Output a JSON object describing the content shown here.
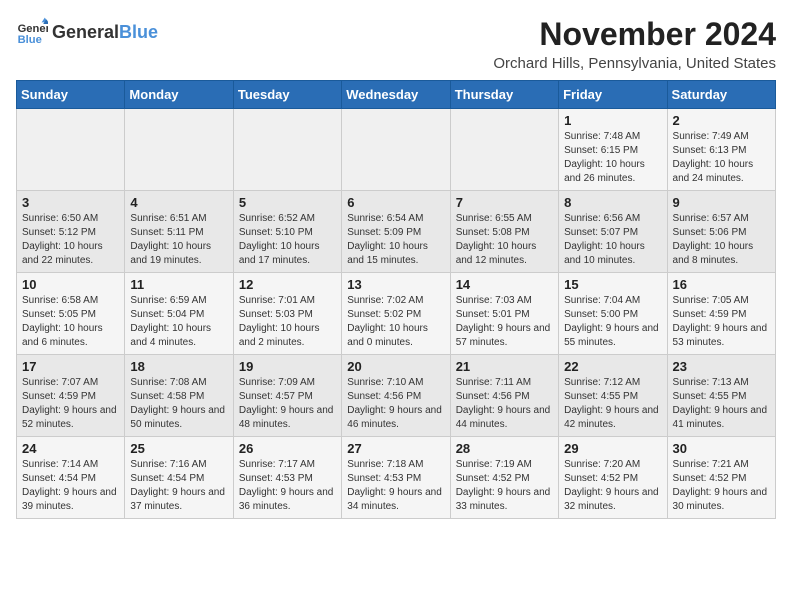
{
  "logo": {
    "general": "General",
    "blue": "Blue"
  },
  "title": "November 2024",
  "subtitle": "Orchard Hills, Pennsylvania, United States",
  "days_of_week": [
    "Sunday",
    "Monday",
    "Tuesday",
    "Wednesday",
    "Thursday",
    "Friday",
    "Saturday"
  ],
  "weeks": [
    [
      {
        "day": "",
        "info": ""
      },
      {
        "day": "",
        "info": ""
      },
      {
        "day": "",
        "info": ""
      },
      {
        "day": "",
        "info": ""
      },
      {
        "day": "",
        "info": ""
      },
      {
        "day": "1",
        "info": "Sunrise: 7:48 AM\nSunset: 6:15 PM\nDaylight: 10 hours and 26 minutes."
      },
      {
        "day": "2",
        "info": "Sunrise: 7:49 AM\nSunset: 6:13 PM\nDaylight: 10 hours and 24 minutes."
      }
    ],
    [
      {
        "day": "3",
        "info": "Sunrise: 6:50 AM\nSunset: 5:12 PM\nDaylight: 10 hours and 22 minutes."
      },
      {
        "day": "4",
        "info": "Sunrise: 6:51 AM\nSunset: 5:11 PM\nDaylight: 10 hours and 19 minutes."
      },
      {
        "day": "5",
        "info": "Sunrise: 6:52 AM\nSunset: 5:10 PM\nDaylight: 10 hours and 17 minutes."
      },
      {
        "day": "6",
        "info": "Sunrise: 6:54 AM\nSunset: 5:09 PM\nDaylight: 10 hours and 15 minutes."
      },
      {
        "day": "7",
        "info": "Sunrise: 6:55 AM\nSunset: 5:08 PM\nDaylight: 10 hours and 12 minutes."
      },
      {
        "day": "8",
        "info": "Sunrise: 6:56 AM\nSunset: 5:07 PM\nDaylight: 10 hours and 10 minutes."
      },
      {
        "day": "9",
        "info": "Sunrise: 6:57 AM\nSunset: 5:06 PM\nDaylight: 10 hours and 8 minutes."
      }
    ],
    [
      {
        "day": "10",
        "info": "Sunrise: 6:58 AM\nSunset: 5:05 PM\nDaylight: 10 hours and 6 minutes."
      },
      {
        "day": "11",
        "info": "Sunrise: 6:59 AM\nSunset: 5:04 PM\nDaylight: 10 hours and 4 minutes."
      },
      {
        "day": "12",
        "info": "Sunrise: 7:01 AM\nSunset: 5:03 PM\nDaylight: 10 hours and 2 minutes."
      },
      {
        "day": "13",
        "info": "Sunrise: 7:02 AM\nSunset: 5:02 PM\nDaylight: 10 hours and 0 minutes."
      },
      {
        "day": "14",
        "info": "Sunrise: 7:03 AM\nSunset: 5:01 PM\nDaylight: 9 hours and 57 minutes."
      },
      {
        "day": "15",
        "info": "Sunrise: 7:04 AM\nSunset: 5:00 PM\nDaylight: 9 hours and 55 minutes."
      },
      {
        "day": "16",
        "info": "Sunrise: 7:05 AM\nSunset: 4:59 PM\nDaylight: 9 hours and 53 minutes."
      }
    ],
    [
      {
        "day": "17",
        "info": "Sunrise: 7:07 AM\nSunset: 4:59 PM\nDaylight: 9 hours and 52 minutes."
      },
      {
        "day": "18",
        "info": "Sunrise: 7:08 AM\nSunset: 4:58 PM\nDaylight: 9 hours and 50 minutes."
      },
      {
        "day": "19",
        "info": "Sunrise: 7:09 AM\nSunset: 4:57 PM\nDaylight: 9 hours and 48 minutes."
      },
      {
        "day": "20",
        "info": "Sunrise: 7:10 AM\nSunset: 4:56 PM\nDaylight: 9 hours and 46 minutes."
      },
      {
        "day": "21",
        "info": "Sunrise: 7:11 AM\nSunset: 4:56 PM\nDaylight: 9 hours and 44 minutes."
      },
      {
        "day": "22",
        "info": "Sunrise: 7:12 AM\nSunset: 4:55 PM\nDaylight: 9 hours and 42 minutes."
      },
      {
        "day": "23",
        "info": "Sunrise: 7:13 AM\nSunset: 4:55 PM\nDaylight: 9 hours and 41 minutes."
      }
    ],
    [
      {
        "day": "24",
        "info": "Sunrise: 7:14 AM\nSunset: 4:54 PM\nDaylight: 9 hours and 39 minutes."
      },
      {
        "day": "25",
        "info": "Sunrise: 7:16 AM\nSunset: 4:54 PM\nDaylight: 9 hours and 37 minutes."
      },
      {
        "day": "26",
        "info": "Sunrise: 7:17 AM\nSunset: 4:53 PM\nDaylight: 9 hours and 36 minutes."
      },
      {
        "day": "27",
        "info": "Sunrise: 7:18 AM\nSunset: 4:53 PM\nDaylight: 9 hours and 34 minutes."
      },
      {
        "day": "28",
        "info": "Sunrise: 7:19 AM\nSunset: 4:52 PM\nDaylight: 9 hours and 33 minutes."
      },
      {
        "day": "29",
        "info": "Sunrise: 7:20 AM\nSunset: 4:52 PM\nDaylight: 9 hours and 32 minutes."
      },
      {
        "day": "30",
        "info": "Sunrise: 7:21 AM\nSunset: 4:52 PM\nDaylight: 9 hours and 30 minutes."
      }
    ]
  ]
}
